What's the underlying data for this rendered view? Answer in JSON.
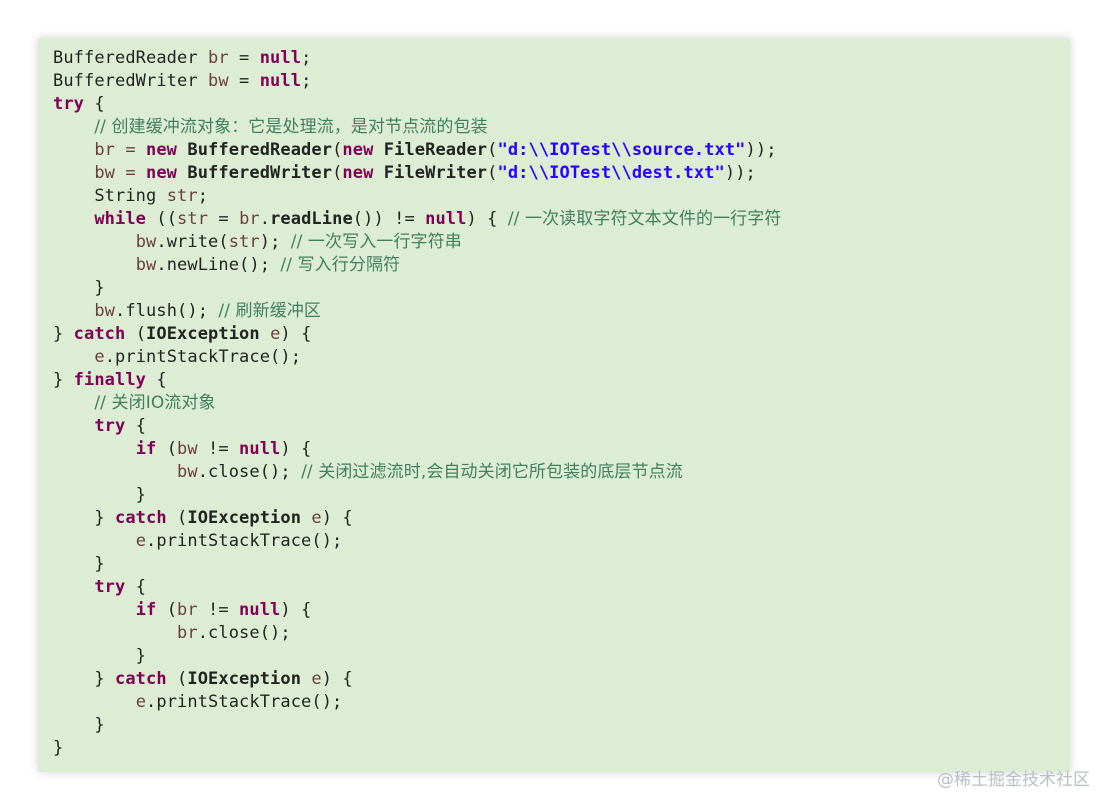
{
  "code_lines": [
    [
      {
        "t": "BufferedReader ",
        "c": ""
      },
      {
        "t": "br",
        "c": "var"
      },
      {
        "t": " = ",
        "c": ""
      },
      {
        "t": "null",
        "c": "null"
      },
      {
        "t": ";",
        "c": ""
      }
    ],
    [
      {
        "t": "BufferedWriter ",
        "c": ""
      },
      {
        "t": "bw",
        "c": "var"
      },
      {
        "t": " = ",
        "c": ""
      },
      {
        "t": "null",
        "c": "null"
      },
      {
        "t": ";",
        "c": ""
      }
    ],
    [
      {
        "t": "try",
        "c": "kw"
      },
      {
        "t": " {",
        "c": ""
      }
    ],
    [
      {
        "t": "    ",
        "c": ""
      },
      {
        "t": "// 创建缓冲流对象：它是处理流，是对节点流的包装",
        "c": "com"
      }
    ],
    [
      {
        "t": "    br = ",
        "c": "var"
      },
      {
        "t": "new",
        "c": "kw"
      },
      {
        "t": " ",
        "c": ""
      },
      {
        "t": "BufferedReader",
        "c": "bold"
      },
      {
        "t": "(",
        "c": ""
      },
      {
        "t": "new",
        "c": "kw"
      },
      {
        "t": " ",
        "c": ""
      },
      {
        "t": "FileReader",
        "c": "bold"
      },
      {
        "t": "(",
        "c": ""
      },
      {
        "t": "\"d:\\\\IOTest\\\\source.txt\"",
        "c": "str"
      },
      {
        "t": "));",
        "c": ""
      }
    ],
    [
      {
        "t": "    bw = ",
        "c": "var"
      },
      {
        "t": "new",
        "c": "kw"
      },
      {
        "t": " ",
        "c": ""
      },
      {
        "t": "BufferedWriter",
        "c": "bold"
      },
      {
        "t": "(",
        "c": ""
      },
      {
        "t": "new",
        "c": "kw"
      },
      {
        "t": " ",
        "c": ""
      },
      {
        "t": "FileWriter",
        "c": "bold"
      },
      {
        "t": "(",
        "c": ""
      },
      {
        "t": "\"d:\\\\IOTest\\\\dest.txt\"",
        "c": "str"
      },
      {
        "t": "));",
        "c": ""
      }
    ],
    [
      {
        "t": "    String ",
        "c": ""
      },
      {
        "t": "str",
        "c": "var"
      },
      {
        "t": ";",
        "c": ""
      }
    ],
    [
      {
        "t": "    ",
        "c": ""
      },
      {
        "t": "while",
        "c": "kw"
      },
      {
        "t": " ((",
        "c": ""
      },
      {
        "t": "str",
        "c": "var"
      },
      {
        "t": " = ",
        "c": ""
      },
      {
        "t": "br",
        "c": "var"
      },
      {
        "t": ".",
        "c": ""
      },
      {
        "t": "readLine",
        "c": "bold"
      },
      {
        "t": "()) != ",
        "c": ""
      },
      {
        "t": "null",
        "c": "null"
      },
      {
        "t": ") { ",
        "c": ""
      },
      {
        "t": "// 一次读取字符文本文件的一行字符",
        "c": "com"
      }
    ],
    [
      {
        "t": "        ",
        "c": ""
      },
      {
        "t": "bw",
        "c": "var"
      },
      {
        "t": ".write(",
        "c": ""
      },
      {
        "t": "str",
        "c": "var"
      },
      {
        "t": "); ",
        "c": ""
      },
      {
        "t": "// 一次写入一行字符串",
        "c": "com"
      }
    ],
    [
      {
        "t": "        ",
        "c": ""
      },
      {
        "t": "bw",
        "c": "var"
      },
      {
        "t": ".newLine(); ",
        "c": ""
      },
      {
        "t": "// 写入行分隔符",
        "c": "com"
      }
    ],
    [
      {
        "t": "    }",
        "c": ""
      }
    ],
    [
      {
        "t": "    ",
        "c": ""
      },
      {
        "t": "bw",
        "c": "var"
      },
      {
        "t": ".flush(); ",
        "c": ""
      },
      {
        "t": "// 刷新缓冲区",
        "c": "com"
      }
    ],
    [
      {
        "t": "} ",
        "c": ""
      },
      {
        "t": "catch",
        "c": "kw"
      },
      {
        "t": " (",
        "c": ""
      },
      {
        "t": "IOException",
        "c": "bold"
      },
      {
        "t": " ",
        "c": ""
      },
      {
        "t": "e",
        "c": "var"
      },
      {
        "t": ") {",
        "c": ""
      }
    ],
    [
      {
        "t": "    ",
        "c": ""
      },
      {
        "t": "e",
        "c": "var"
      },
      {
        "t": ".printStackTrace();",
        "c": ""
      }
    ],
    [
      {
        "t": "} ",
        "c": ""
      },
      {
        "t": "finally",
        "c": "kw"
      },
      {
        "t": " {",
        "c": ""
      }
    ],
    [
      {
        "t": "    ",
        "c": ""
      },
      {
        "t": "// 关闭IO流对象",
        "c": "com"
      }
    ],
    [
      {
        "t": "    ",
        "c": ""
      },
      {
        "t": "try",
        "c": "kw"
      },
      {
        "t": " {",
        "c": ""
      }
    ],
    [
      {
        "t": "        ",
        "c": ""
      },
      {
        "t": "if",
        "c": "kw"
      },
      {
        "t": " (",
        "c": ""
      },
      {
        "t": "bw",
        "c": "var"
      },
      {
        "t": " != ",
        "c": ""
      },
      {
        "t": "null",
        "c": "null"
      },
      {
        "t": ") {",
        "c": ""
      }
    ],
    [
      {
        "t": "            ",
        "c": ""
      },
      {
        "t": "bw",
        "c": "var"
      },
      {
        "t": ".close(); ",
        "c": ""
      },
      {
        "t": "// 关闭过滤流时,会自动关闭它所包装的底层节点流",
        "c": "com"
      }
    ],
    [
      {
        "t": "        }",
        "c": ""
      }
    ],
    [
      {
        "t": "    } ",
        "c": ""
      },
      {
        "t": "catch",
        "c": "kw"
      },
      {
        "t": " (",
        "c": ""
      },
      {
        "t": "IOException",
        "c": "bold"
      },
      {
        "t": " ",
        "c": ""
      },
      {
        "t": "e",
        "c": "var"
      },
      {
        "t": ") {",
        "c": ""
      }
    ],
    [
      {
        "t": "        ",
        "c": ""
      },
      {
        "t": "e",
        "c": "var"
      },
      {
        "t": ".printStackTrace();",
        "c": ""
      }
    ],
    [
      {
        "t": "    }",
        "c": ""
      }
    ],
    [
      {
        "t": "    ",
        "c": ""
      },
      {
        "t": "try",
        "c": "kw"
      },
      {
        "t": " {",
        "c": ""
      }
    ],
    [
      {
        "t": "        ",
        "c": ""
      },
      {
        "t": "if",
        "c": "kw"
      },
      {
        "t": " (",
        "c": ""
      },
      {
        "t": "br",
        "c": "var"
      },
      {
        "t": " != ",
        "c": ""
      },
      {
        "t": "null",
        "c": "null"
      },
      {
        "t": ") {",
        "c": ""
      }
    ],
    [
      {
        "t": "            ",
        "c": ""
      },
      {
        "t": "br",
        "c": "var"
      },
      {
        "t": ".close();",
        "c": ""
      }
    ],
    [
      {
        "t": "        }",
        "c": ""
      }
    ],
    [
      {
        "t": "    } ",
        "c": ""
      },
      {
        "t": "catch",
        "c": "kw"
      },
      {
        "t": " (",
        "c": ""
      },
      {
        "t": "IOException",
        "c": "bold"
      },
      {
        "t": " ",
        "c": ""
      },
      {
        "t": "e",
        "c": "var"
      },
      {
        "t": ") {",
        "c": ""
      }
    ],
    [
      {
        "t": "        ",
        "c": ""
      },
      {
        "t": "e",
        "c": "var"
      },
      {
        "t": ".printStackTrace();",
        "c": ""
      }
    ],
    [
      {
        "t": "    }",
        "c": ""
      }
    ],
    [
      {
        "t": "}",
        "c": ""
      }
    ]
  ],
  "watermark": "@稀土掘金技术社区",
  "colors": {
    "background": "#ddedd3",
    "keyword": "#7f0055",
    "string": "#2a00ff",
    "comment": "#3f7f5f",
    "variable": "#6a3e3e"
  }
}
